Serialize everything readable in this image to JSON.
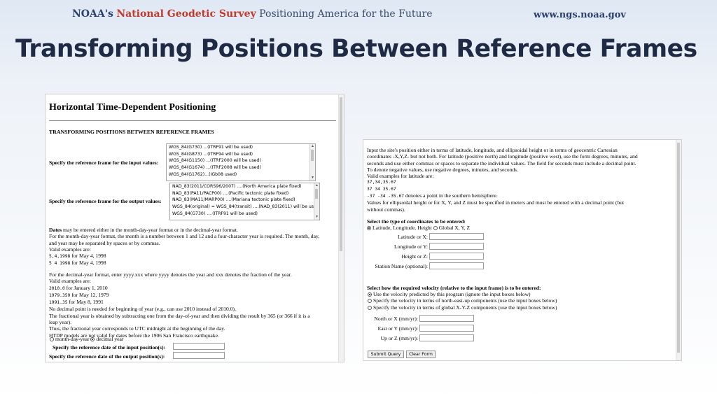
{
  "banner": {
    "noaa": "NOAA's",
    "ngs": "National Geodetic Survey",
    "tagline": "Positioning America for the Future",
    "url": "www.ngs.noaa.gov"
  },
  "slide_title": "Transforming Positions Between Reference Frames",
  "left": {
    "title": "Horizontal Time-Dependent Positioning",
    "subtitle": "TRANSFORMING POSITIONS BETWEEN REFERENCE FRAMES",
    "input_frame_label": "Specify the reference frame for the input values:",
    "input_frames": [
      "WGS_84(G730) ...(ITRF91 will be used)",
      "WGS_84(G873) ...(ITRF94 will be used)",
      "WGS_84(G1150) ...(ITRF2000 will be used)",
      "WGS_84(G1674) ...(ITRF2008 will be used)",
      "WGS_84(G1762)...(IGb08 used)"
    ],
    "output_frame_label": "Specify the reference frame for the output values:",
    "output_frames": [
      "NAD_83(2011/CORS96/2007) ....(North America plate fixed)",
      "NAD_83(PA11/PACP00) ....(Pacific tectonic plate fixed)",
      "NAD_83(MA11/MARP00) ....(Mariana tectonic plate fixed)",
      "WGS_84(original) = WGS_84(transit) ....(NAD_83(2011) will be used)",
      "WGS_84(G730) ....(ITRF91 will be used)"
    ],
    "dates_bold": "Dates",
    "dates_lines": [
      " may be entered either in the month-day-year format or in the decimal-year format.",
      "For the month-day-year format, the month is a number between 1 and 12 and a four-character year is required. The month, day,",
      "and year may be separated by spaces or by commas.",
      "Valid examples are:"
    ],
    "mdy_examples": [
      {
        "code": "5,4,1998",
        "text": " for May 4, 1998"
      },
      {
        "code": "5 4 1998",
        "text": " for May 4, 1998"
      }
    ],
    "decimal_intro": "For the decimal-year format, enter yyyy.xxx where yyyy denotes the year and xxx denotes the fraction of the year.",
    "decimal_valid": "Valid examples are:",
    "decimal_examples": [
      {
        "code": "2010.0",
        "text": " for January 1, 2010"
      },
      {
        "code": "1979.359",
        "text": " for May 12, 1979"
      },
      {
        "code": "1991.35",
        "text": " for May 8, 1991"
      }
    ],
    "notes": [
      "No decimal point is needed for beginning of year (e.g., can use 2010 instead of 2010.0).",
      "The fractional year is obtained by subtracting one from the day-of-year and then dividing the result by 365 (or 366 if it is a",
      "leap year).",
      "Thus, the fractional year corresponds to UTC midnight at the beginning of the day.",
      "HTDP models are not valid for dates before the 1906 San Francisco earthquake."
    ],
    "radio_mdy": "month-day-year",
    "radio_decimal": "decimal year",
    "input_date_label": "Specify the reference date of the input position(s):",
    "output_date_label": "Specify the reference date of the output position(s):"
  },
  "right": {
    "intro": [
      "Input the site's position either in terms of latitude, longitude, and ellipsoidal height or in terms of geocentric Cartesian",
      "coordinates -X,Y,Z- but not both. For latitude (positive north) and longitude (positive west), use the form degrees, minutes, and",
      "seconds and use either commas or spaces to separate the individual values. The field for seconds must include a decimal point.",
      "To denote negative values, use negative degrees, minutes, and seconds.",
      "Valid examples for latitude are:"
    ],
    "lat_examples": [
      "37,34,35.67",
      "37 34 35.67"
    ],
    "lat_neg_code": "-37 -34 -35.67",
    "lat_neg_text": " denotes a point in the southern hemisphere.",
    "ellip_note": [
      "Values for ellipsoidal height or for X, Y, and Z must be specified in meters and must be entered with a decimal point (but",
      "without commas)."
    ],
    "coord_type_label": "Select the type of coordinates to be entered:",
    "radio_llh": "Latitude, Longitude, Height",
    "radio_xyz": "Global X, Y, Z",
    "fields": {
      "lat": "Latitude or X:",
      "lon": "Longitude or Y:",
      "height": "Height or Z:",
      "station": "Station Name (optional):"
    },
    "velocity_label": "Select how the required velocity (relative to the input frame) is to be entered:",
    "vel_options": [
      "Use the velocity predicted by this program (ignore the input boxes below)",
      "Specify the velocity in terms of north-east-up components (use the input boxes below)",
      "Specify the velocity in terms of global X-Y-Z components (use the input boxes below)"
    ],
    "vel_fields": {
      "north": "North or X (mm/yr):",
      "east": "East or Y (mm/yr):",
      "up": "Up or Z (mm/yr):"
    },
    "submit": "Submit Query",
    "clear": "Clear Form"
  }
}
